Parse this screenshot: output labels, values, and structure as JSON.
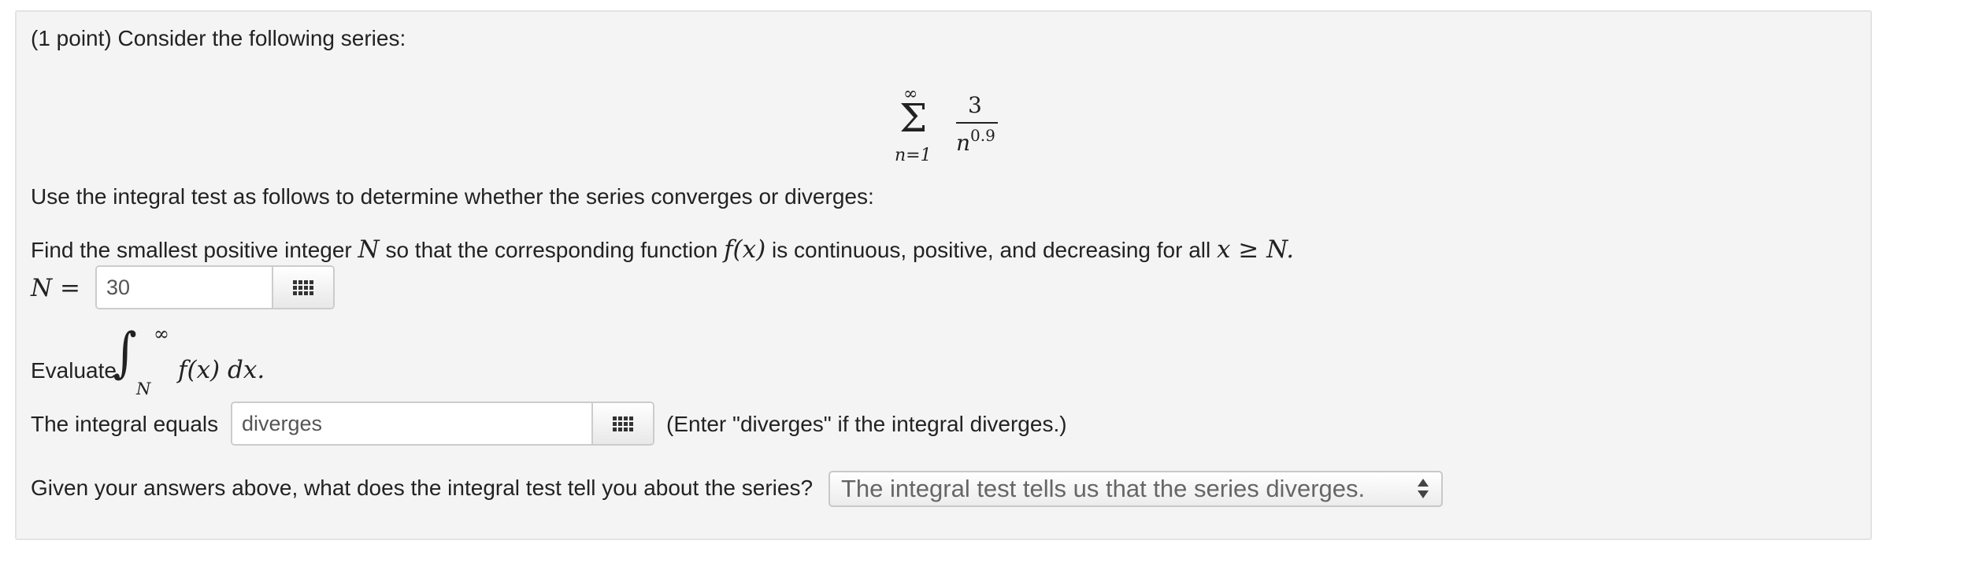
{
  "problem": {
    "intro": "(1 point) Consider the following series:",
    "series": {
      "upper_limit": "∞",
      "lower_limit": "n=1",
      "numerator": "3",
      "denominator_base": "n",
      "denominator_exponent": "0.9"
    },
    "instruction": "Use the integral test as follows to determine whether the series converges or diverges:",
    "find_N": {
      "text_before": "Find the smallest positive integer",
      "var_N": "N",
      "text_middle": "so that the corresponding function",
      "func": "f(x)",
      "text_after": "is continuous, positive, and decreasing for all",
      "condition": "x ≥ N.",
      "answer_label": "N =",
      "answer_value": "30"
    },
    "evaluate": {
      "label": "Evaluate",
      "upper": "∞",
      "lower": "N",
      "integrand": "f(x) dx."
    },
    "integral_answer": {
      "label": "The integral equals",
      "value": "diverges",
      "hint": "(Enter \"diverges\" if the integral diverges.)"
    },
    "conclusion": {
      "question": "Given your answers above, what does the integral test tell you about the series?",
      "selected": "The integral test tells us that the series diverges."
    }
  },
  "icons": {
    "input_helper": "grid-icon",
    "select_arrows": "updown-arrows-icon"
  }
}
